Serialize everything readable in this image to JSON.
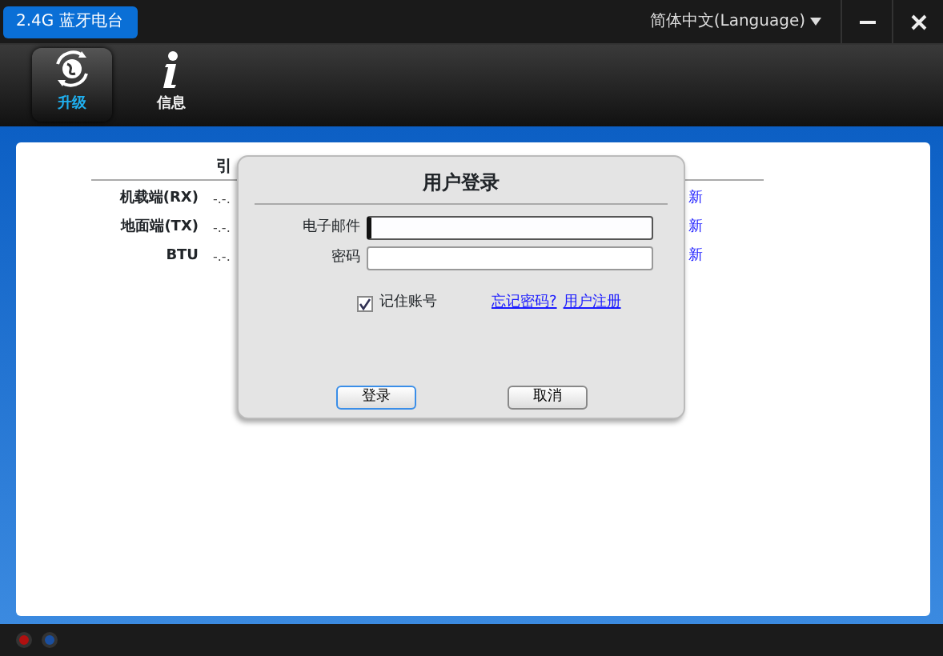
{
  "window": {
    "title": "2.4G  蓝牙电台",
    "language": "简体中文(Language)"
  },
  "toolbar": [
    {
      "label": "升级",
      "selected": true
    },
    {
      "label": "信息",
      "selected": false
    }
  ],
  "panel": {
    "header": "引",
    "rows": [
      {
        "label": "机载端(RX)",
        "value": "-.-.",
        "action": "新"
      },
      {
        "label": "地面端(TX)",
        "value": "-.-.",
        "action": "新"
      },
      {
        "label": "BTU",
        "value": "-.-.",
        "action": "新"
      }
    ]
  },
  "dialog": {
    "title": "用户登录",
    "fields": [
      {
        "label": "电子邮件",
        "focused": true
      },
      {
        "label": "密码",
        "focused": false
      }
    ],
    "remember": {
      "label": "记住账号",
      "checked": true
    },
    "links": [
      "忘记密码?",
      "用户注册"
    ],
    "buttons": [
      {
        "label": "登录",
        "default": true
      },
      {
        "label": "取消",
        "default": false
      }
    ]
  },
  "status_leds": [
    {
      "color": "#b01010"
    },
    {
      "color": "#1a4fa0"
    }
  ]
}
